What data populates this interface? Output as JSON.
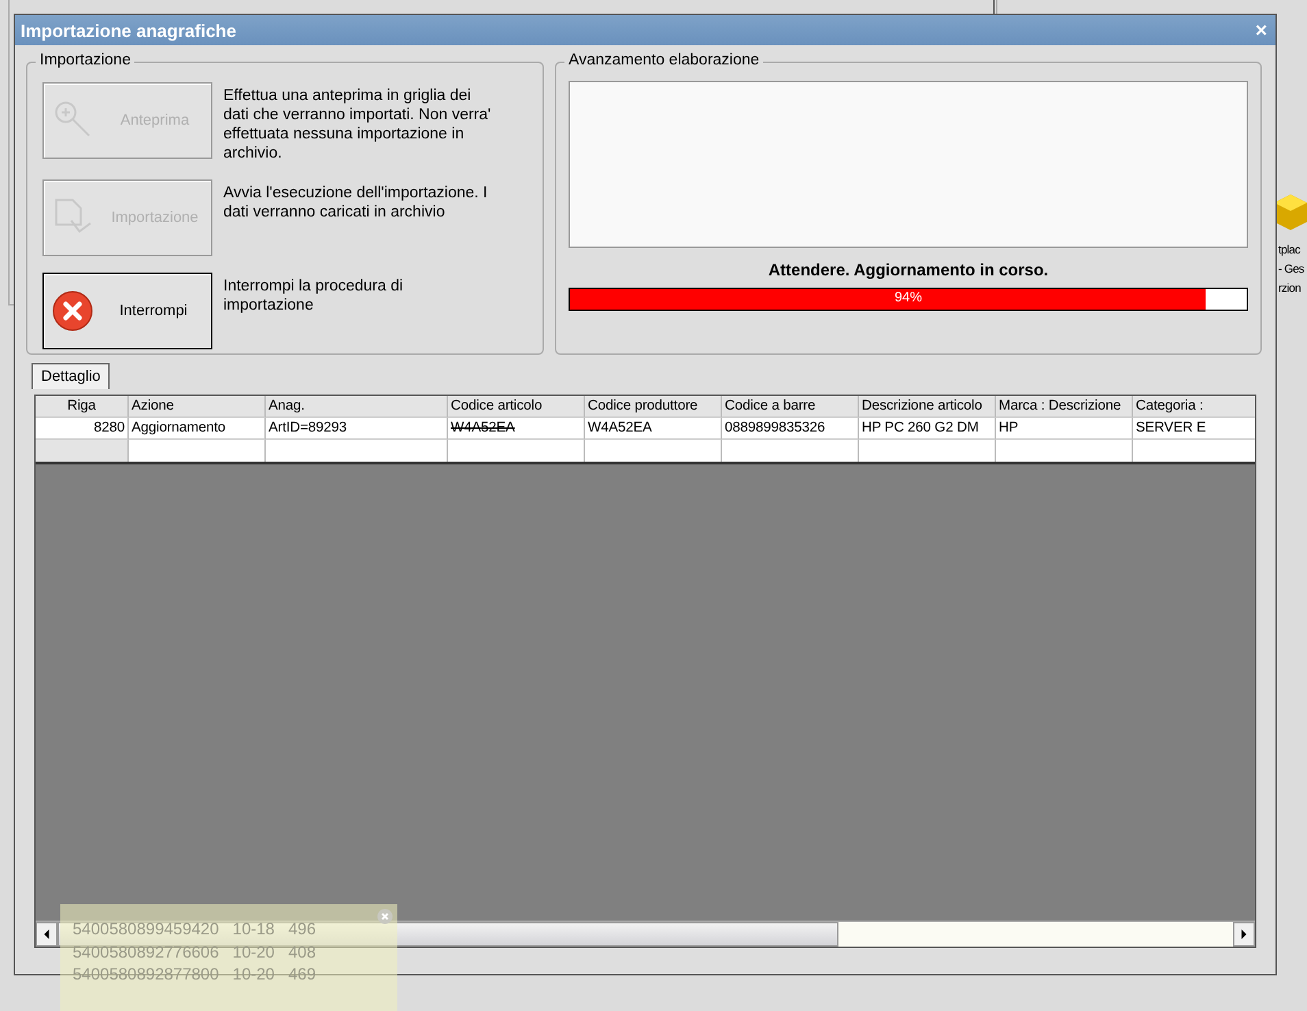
{
  "background": {
    "desktop_labels": [
      "tplac",
      "- Ges",
      "rzion"
    ]
  },
  "window": {
    "title": "Importazione anagrafiche",
    "close": "×"
  },
  "import_group": {
    "title": "Importazione",
    "actions": [
      {
        "kind": "preview",
        "label": "Anteprima",
        "disabled": true,
        "description": "Effettua una anteprima in griglia dei dati che verranno importati. Non verra' effettuata nessuna importazione in archivio."
      },
      {
        "kind": "import",
        "label": "Importazione",
        "disabled": true,
        "description": "Avvia l'esecuzione dell'importazione. I dati verranno caricati in archivio"
      },
      {
        "kind": "stop",
        "label": "Interrompi",
        "disabled": false,
        "description": "Interrompi la procedura di importazione"
      }
    ]
  },
  "progress_group": {
    "title": "Avanzamento elaborazione",
    "status": "Attendere. Aggiornamento in corso.",
    "level": 0.94,
    "reading": "94%"
  },
  "tabs": [
    {
      "label": "Dettaglio",
      "selected": true
    }
  ],
  "table": {
    "columns": [
      "Riga",
      "Azione",
      "Anag.",
      "Codice articolo",
      "Codice produttore",
      "Codice a barre",
      "Descrizione articolo",
      "Marca : Descrizione",
      "Categoria :"
    ],
    "rows": [
      {
        "cells": [
          {
            "text": "8280",
            "struck": false
          },
          {
            "text": "Aggiornamento",
            "struck": false
          },
          {
            "text": "ArtID=89293",
            "struck": false
          },
          {
            "text": "W4A52EA",
            "struck": true
          },
          {
            "text": "W4A52EA",
            "struck": false
          },
          {
            "text": "0889899835326",
            "struck": false
          },
          {
            "text": "HP PC 260 G2 DM",
            "struck": false
          },
          {
            "text": "HP",
            "struck": false
          },
          {
            "text": "SERVER E",
            "struck": false
          }
        ]
      }
    ]
  },
  "tooltip": {
    "lines": [
      "5400580899459420   10-18   496",
      "5400580892776606   10-20   408",
      "5400580892877800   10-20   469"
    ]
  }
}
